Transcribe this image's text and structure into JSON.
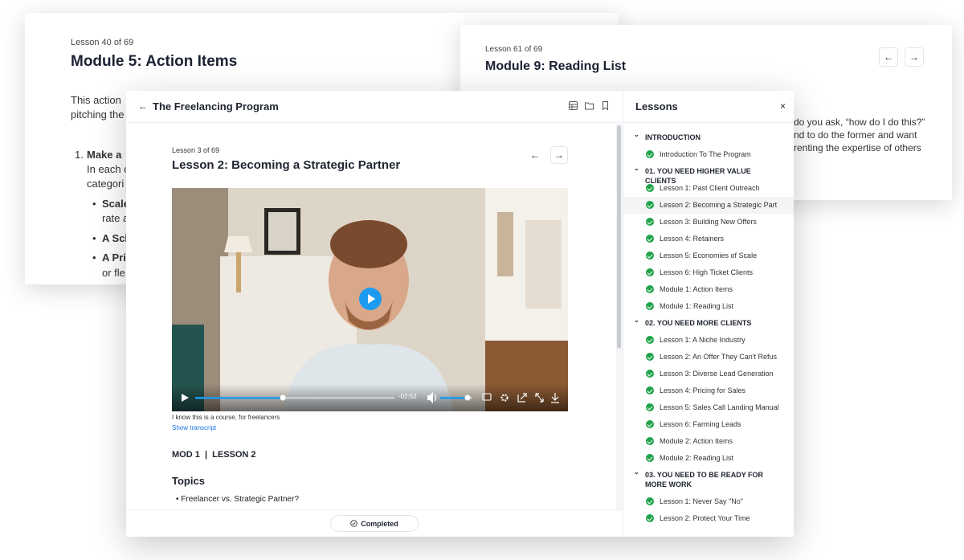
{
  "bg_card_1": {
    "meta": "Lesson 40 of 69",
    "title": "Module 5: Action Items",
    "intro_line1": "This action",
    "intro_line2": "pitching the",
    "item1_num": "1.",
    "item1_bold": "Make a",
    "item1_line2": "In each c",
    "item1_line3": "categori",
    "bullets": [
      "Scale",
      "rate a",
      "A Sch",
      "A Pri",
      "or fle"
    ]
  },
  "bg_card_2": {
    "meta": "Lesson 61 of 69",
    "title": "Module 9: Reading List",
    "body": [
      "do you ask, “how do I do this?”",
      "nd to do the former and want",
      "renting the expertise of others"
    ],
    "prev_icon": "arrow-left-icon",
    "next_icon": "arrow-right-icon"
  },
  "header": {
    "back_icon": "arrow-left-icon",
    "course_title": "The Freelancing Program",
    "icons": [
      "table-icon",
      "folder-icon",
      "bookmark-icon"
    ]
  },
  "lesson": {
    "meta": "Lesson 3 of 69",
    "title": "Lesson 2: Becoming a Strategic Partner",
    "prev_icon": "arrow-left-icon",
    "next_icon": "arrow-right-icon"
  },
  "video": {
    "time_remaining": "-02:52",
    "progress": 0.44,
    "volume": 0.85,
    "accent": "#1d9bf0",
    "caption": "I know this is a course, for freelancers",
    "transcript_link": "Show transcript"
  },
  "body": {
    "module_label": "MOD 1  |  LESSON 2",
    "topics_heading": "Topics",
    "topics": [
      "Freelancer vs. Strategic Partner?"
    ]
  },
  "footer": {
    "completed_label": "Completed"
  },
  "sidebar": {
    "title": "Lessons",
    "close_icon": "close-icon",
    "check_color": "#1fa34a",
    "sections": [
      {
        "title": "INTRODUCTION",
        "lessons": [
          "Introduction To The Program"
        ]
      },
      {
        "title": "01. YOU NEED HIGHER VALUE CLIENTS",
        "lessons": [
          "Lesson 1: Past Client Outreach",
          "Lesson 2: Becoming a Strategic Part",
          "Lesson 3: Building New Offers",
          "Lesson 4: Retainers",
          "Lesson 5: Economies of Scale",
          "Lesson 6: High Ticket Clients",
          "Module 1: Action Items",
          "Module 1: Reading List"
        ]
      },
      {
        "title": "02. YOU NEED MORE CLIENTS",
        "lessons": [
          "Lesson 1: A Niche Industry",
          "Lesson 2: An Offer They Can't Refus",
          "Lesson 3: Diverse Lead Generation",
          "Lesson 4: Pricing for Sales",
          "Lesson 5: Sales Call Landing Manual",
          "Lesson 6: Farming Leads",
          "Module 2: Action Items",
          "Module 2: Reading List"
        ]
      },
      {
        "title": "03. YOU NEED TO BE READY FOR MORE WORK",
        "lessons": [
          "Lesson 1: Never Say \"No\"",
          "Lesson 2: Protect Your Time"
        ]
      }
    ]
  }
}
